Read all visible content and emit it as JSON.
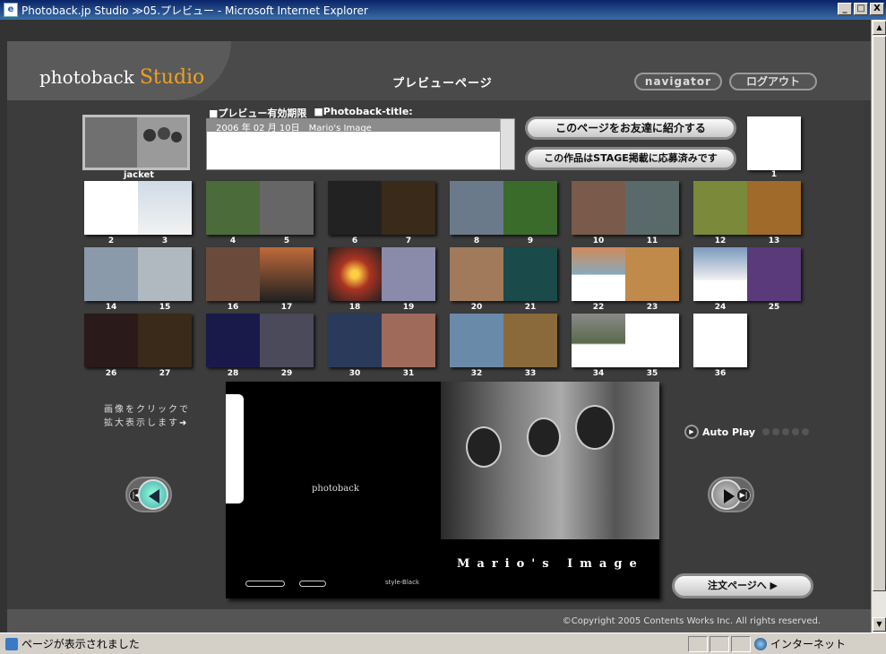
{
  "window": {
    "title": "Photoback.jp Studio ≫05.プレビュー - Microsoft Internet Explorer",
    "buttons": [
      "_",
      "□",
      "X"
    ]
  },
  "header": {
    "logo": "photoback",
    "logo_suffix": "Studio",
    "page_title": "プレビューページ",
    "navigator_label": "navigator",
    "logout_label": "ログアウト"
  },
  "info": {
    "expiry_head": "■プレビュー有効期限",
    "title_head": "■Photoback-title:",
    "row": "2006 年 02 月 10日　Mario's Image"
  },
  "buttons": {
    "share": "このページをお友達に紹介する",
    "stage": "この作品はSTAGE掲載に応募済みです",
    "order": "注文ページへ ▶"
  },
  "jacket_label": "jacket",
  "thumbnails": {
    "row1": [
      {
        "nums": [
          "2",
          "3"
        ]
      },
      {
        "nums": [
          "4",
          "5"
        ]
      },
      {
        "nums": [
          "6",
          "7"
        ]
      },
      {
        "nums": [
          "8",
          "9"
        ]
      },
      {
        "nums": [
          "10",
          "11"
        ]
      },
      {
        "nums": [
          "12",
          "13"
        ]
      }
    ],
    "row2": [
      {
        "nums": [
          "14",
          "15"
        ]
      },
      {
        "nums": [
          "16",
          "17"
        ]
      },
      {
        "nums": [
          "18",
          "19"
        ]
      },
      {
        "nums": [
          "20",
          "21"
        ]
      },
      {
        "nums": [
          "22",
          "23"
        ]
      },
      {
        "nums": [
          "24",
          "25"
        ]
      }
    ],
    "row3": [
      {
        "nums": [
          "26",
          "27"
        ]
      },
      {
        "nums": [
          "28",
          "29"
        ]
      },
      {
        "nums": [
          "30",
          "31"
        ]
      },
      {
        "nums": [
          "32",
          "33"
        ]
      },
      {
        "nums": [
          "34",
          "35"
        ]
      }
    ],
    "page1": "1",
    "page36": "36"
  },
  "hint": {
    "line1": "画像をクリックで",
    "line2": "拡大表示します"
  },
  "preview": {
    "brand": "photoback",
    "caption": "Mario's Image",
    "small": "style-Black"
  },
  "autoplay_label": "Auto Play",
  "footer": "©Copyright 2005 Contents Works Inc.  All rights reserved.",
  "statusbar": {
    "message": "ページが表示されました",
    "zone": "インターネット"
  },
  "colors": {
    "accent": "#f0a020",
    "page_bg": "#3c3c3c"
  }
}
